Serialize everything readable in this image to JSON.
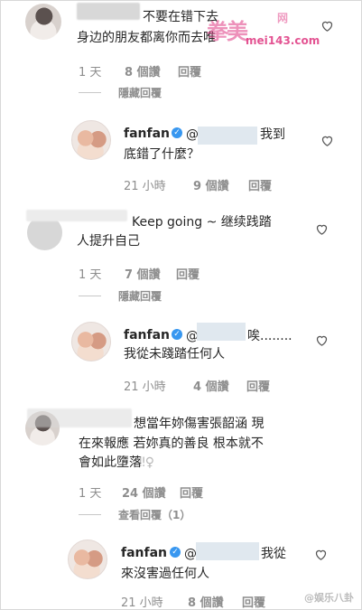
{
  "comments": [
    {
      "text_lines": [
        "不要在错下去",
        "身边的朋友都离你而去唯"
      ],
      "time": "1 天",
      "likes": "8 個讚",
      "reply": "回覆",
      "thread_toggle": "隱藏回覆"
    },
    {
      "user": "fanfan",
      "text_lines": [
        "我到",
        "底錯了什麼？"
      ],
      "time": "21 小時",
      "likes": "9 個讚",
      "reply": "回覆"
    },
    {
      "text_lines": [
        "Keep going ~ 继续践踏",
        "人提升自己"
      ],
      "time": "1 天",
      "likes": "7 個讚",
      "reply": "回覆",
      "thread_toggle": "隱藏回覆"
    },
    {
      "user": "fanfan",
      "text_lines": [
        "唉........",
        "我從未踐踏任何人"
      ],
      "time": "21 小時",
      "likes": "4 個讚",
      "reply": "回覆"
    },
    {
      "text_lines": [
        "想當年妳傷害張韶涵 現",
        "在來報應 若妳真的善良 根本就不",
        "會如此墮落"
      ],
      "time": "1 天",
      "likes": "24 個讚",
      "reply": "回覆",
      "thread_toggle": "查看回覆（1）"
    },
    {
      "user": "fanfan",
      "text_lines": [
        "我從",
        "來沒害過任何人"
      ],
      "time": "21 小時",
      "likes": "8 個讚",
      "reply": "回覆"
    }
  ],
  "watermark": {
    "site_glyphs": "拳美",
    "site_url": "mei143.com",
    "site_top": "网",
    "corner": "@娱乐八卦"
  },
  "icons": {
    "heart": "heart-outline-icon",
    "verified": "verified-badge-icon"
  }
}
